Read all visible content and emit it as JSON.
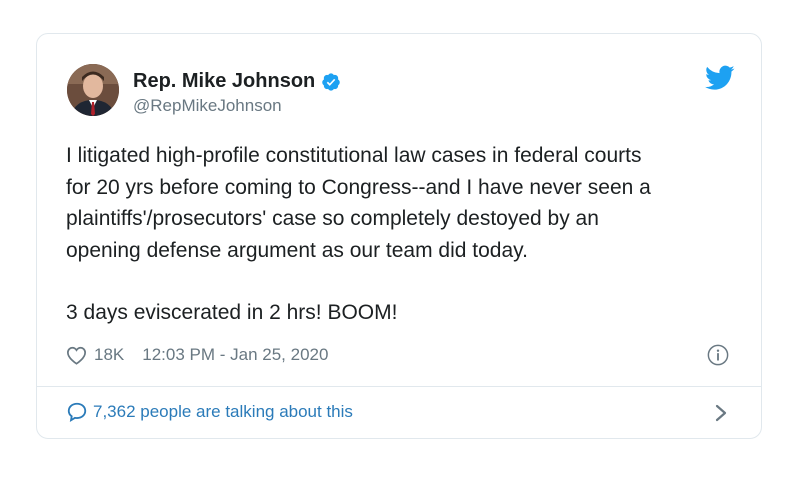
{
  "tweet": {
    "author_name": "Rep. Mike Johnson",
    "handle": "@RepMikeJohnson",
    "paragraph1": [
      "I litigated high-profile constitutional law cases in federal courts",
      "for 20 yrs before coming to Congress--and I have never seen a",
      "plaintiffs'/prosecutors' case so completely destoyed by an",
      "opening defense argument as our team did today."
    ],
    "paragraph2": "3 days eviscerated in 2 hrs! BOOM!",
    "likes": "18K",
    "timestamp": "12:03 PM - Jan 25, 2020",
    "talking": "7,362 people are talking about this"
  },
  "colors": {
    "accent": "#1da1f2",
    "link": "#2b7bb9",
    "muted": "#697882",
    "border": "#e1e8ed"
  },
  "icons": [
    "verified-badge-icon",
    "twitter-bird-icon",
    "heart-icon",
    "info-icon",
    "speech-bubble-icon",
    "chevron-right-icon"
  ]
}
